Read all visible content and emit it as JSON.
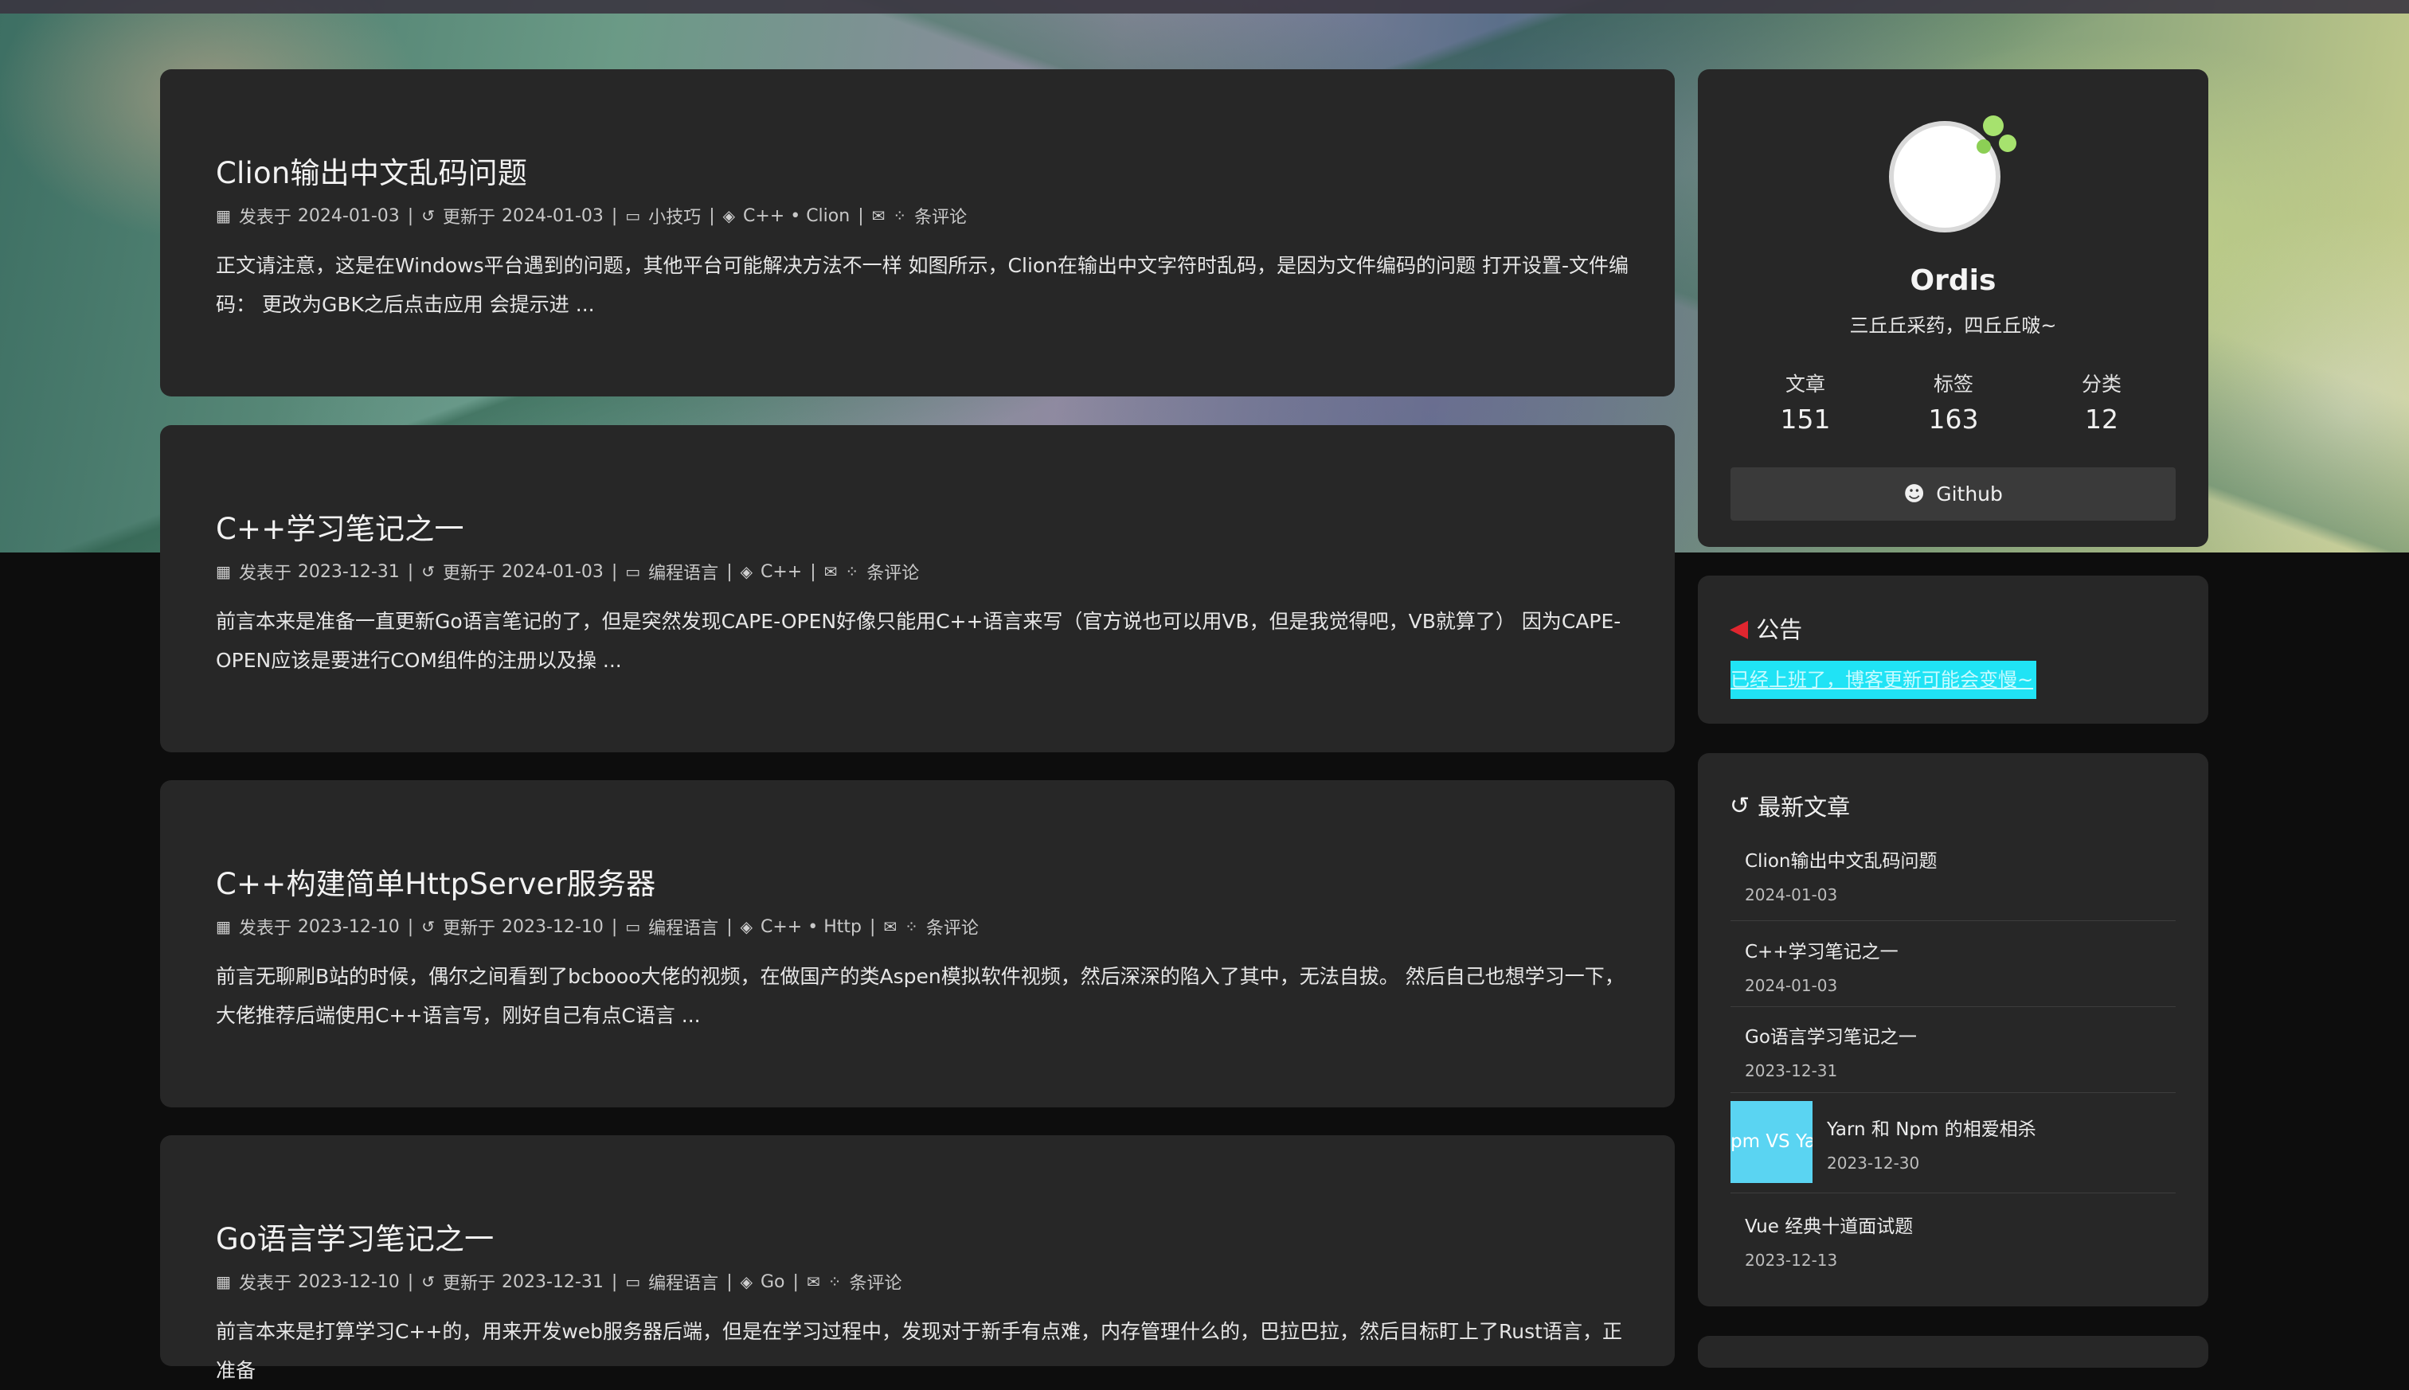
{
  "posts": [
    {
      "title": "Clion输出中文乱码问题",
      "published_label": "发表于",
      "published": "2024-01-03",
      "updated_label": "更新于",
      "updated": "2024-01-03",
      "category": "小技巧",
      "tags": "C++ • Clion",
      "comments": "条评论",
      "excerpt": "正文请注意，这是在Windows平台遇到的问题，其他平台可能解决方法不一样 如图所示，Clion在输出中文字符时乱码，是因为文件编码的问题 打开设置-文件编码： 更改为GBK之后点击应用 会提示进 ..."
    },
    {
      "title": "C++学习笔记之一",
      "published_label": "发表于",
      "published": "2023-12-31",
      "updated_label": "更新于",
      "updated": "2024-01-03",
      "category": "编程语言",
      "tags": "C++",
      "comments": "条评论",
      "excerpt": "前言本来是准备一直更新Go语言笔记的了，但是突然发现CAPE-OPEN好像只能用C++语言来写（官方说也可以用VB，但是我觉得吧，VB就算了） 因为CAPE-OPEN应该是要进行COM组件的注册以及操 ..."
    },
    {
      "title": "C++构建简单HttpServer服务器",
      "published_label": "发表于",
      "published": "2023-12-10",
      "updated_label": "更新于",
      "updated": "2023-12-10",
      "category": "编程语言",
      "tags": "C++ • Http",
      "comments": "条评论",
      "excerpt": "前言无聊刷B站的时候，偶尔之间看到了bcbooo大佬的视频，在做国产的类Aspen模拟软件视频，然后深深的陷入了其中，无法自拔。 然后自己也想学习一下，大佬推荐后端使用C++语言写，刚好自己有点C语言 ..."
    },
    {
      "title": "Go语言学习笔记之一",
      "published_label": "发表于",
      "published": "2023-12-10",
      "updated_label": "更新于",
      "updated": "2023-12-31",
      "category": "编程语言",
      "tags": "Go",
      "comments": "条评论",
      "excerpt": "前言本来是打算学习C++的，用来开发web服务器后端，但是在学习过程中，发现对于新手有点难，内存管理什么的，巴拉巴拉，然后目标盯上了Rust语言，正准备"
    }
  ],
  "profile": {
    "name": "Ordis",
    "description": "三丘丘采药，四丘丘啵~",
    "stats": [
      {
        "label": "文章",
        "value": "151"
      },
      {
        "label": "标签",
        "value": "163"
      },
      {
        "label": "分类",
        "value": "12"
      }
    ],
    "github_label": "Github"
  },
  "announcement": {
    "title": "公告",
    "text": "已经上班了，博客更新可能会变慢~"
  },
  "recent": {
    "title": "最新文章",
    "items": [
      {
        "title": "Clion输出中文乱码问题",
        "date": "2024-01-03"
      },
      {
        "title": "C++学习笔记之一",
        "date": "2024-01-03"
      },
      {
        "title": "Go语言学习笔记之一",
        "date": "2023-12-31"
      },
      {
        "title": "Yarn 和 Npm 的相爱相杀",
        "date": "2023-12-30",
        "thumb_text": "pm VS Yar"
      },
      {
        "title": "Vue 经典十道面试题",
        "date": "2023-12-13"
      }
    ]
  },
  "colors": {
    "card": "#272727",
    "accent_announce": "#20e3f5",
    "megaphone": "#e0262f",
    "thumb_bg": "#5ad4f2"
  }
}
